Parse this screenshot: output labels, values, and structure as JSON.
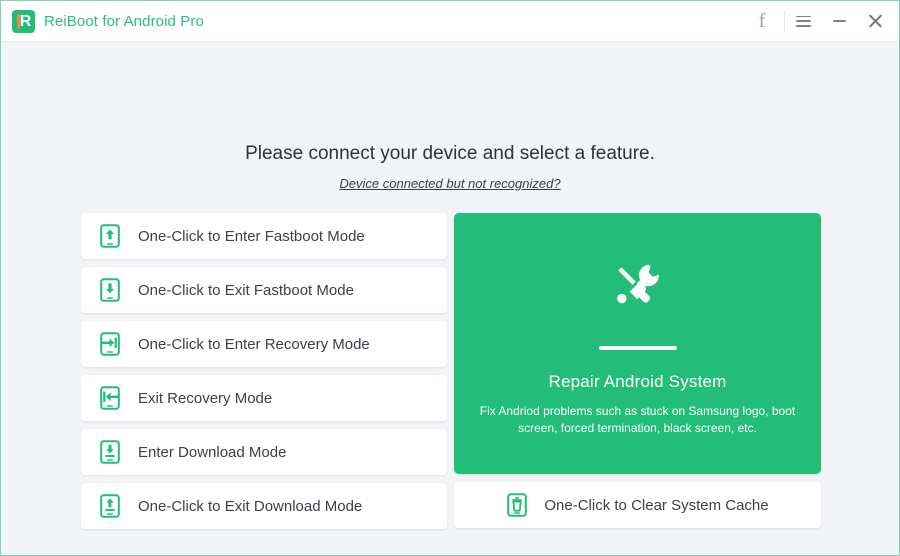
{
  "window": {
    "accent_color": "#22bd78",
    "background_color": "#f2f4f8",
    "border_color": "#7fd3b4"
  },
  "titlebar": {
    "logo_letter": "R",
    "app_title": "ReiBoot for Android Pro",
    "facebook_label": "f",
    "icons": {
      "facebook": "facebook-icon",
      "menu": "hamburger-menu-icon",
      "minimize": "minimize-icon",
      "close": "close-icon"
    }
  },
  "main": {
    "headline": "Please connect your device and select a feature.",
    "help_link": "Device connected but not recognized?",
    "left_buttons": [
      {
        "label": "One-Click to Enter Fastboot Mode",
        "icon": "phone-arrow-up-icon"
      },
      {
        "label": "One-Click to Exit Fastboot Mode",
        "icon": "phone-arrow-down-icon"
      },
      {
        "label": "One-Click to Enter Recovery Mode",
        "icon": "phone-arrow-in-icon"
      },
      {
        "label": "Exit Recovery Mode",
        "icon": "phone-arrow-out-icon"
      },
      {
        "label": "Enter Download Mode",
        "icon": "phone-download-icon"
      },
      {
        "label": "One-Click to Exit Download Mode",
        "icon": "phone-upload-icon"
      }
    ],
    "repair_card": {
      "icon": "screwdriver-wrench-icon",
      "title": "Repair Android System",
      "description": "Fix Andriod problems such as stuck on Samsung logo, boot screen, forced termination, black screen, etc."
    },
    "cache_button": {
      "label": "One-Click to Clear System Cache",
      "icon": "phone-trash-icon"
    }
  }
}
